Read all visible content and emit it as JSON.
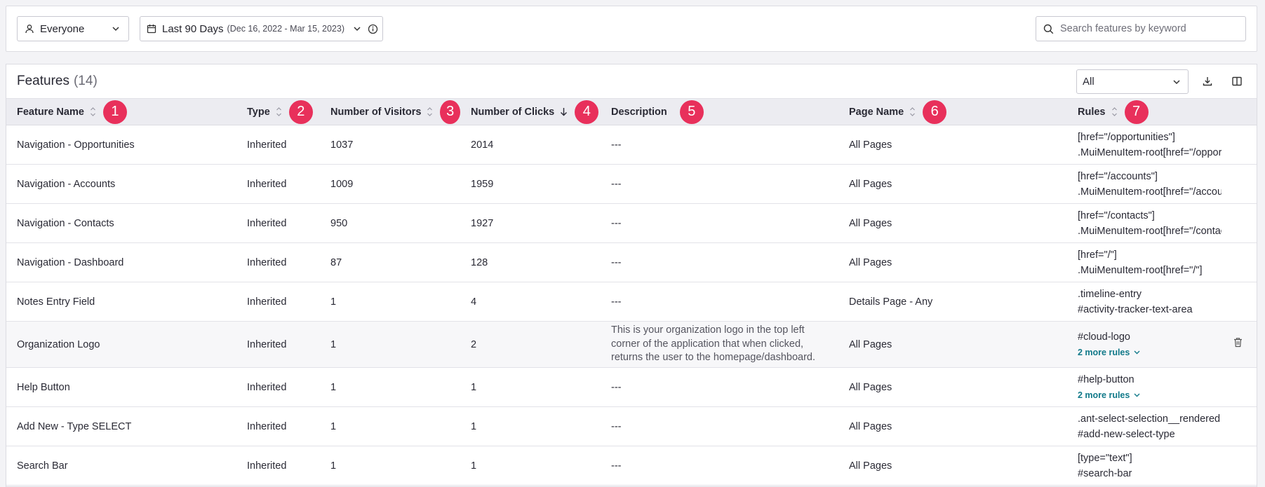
{
  "filters": {
    "segment": "Everyone",
    "date_range": "Last 90 Days",
    "date_detail": "(Dec 16, 2022 - Mar 15, 2023)",
    "search_placeholder": "Search features by keyword"
  },
  "card": {
    "title": "Features",
    "count": "(14)",
    "type_filter": "All"
  },
  "columns": [
    {
      "label": "Feature Name",
      "badge": "1"
    },
    {
      "label": "Type",
      "badge": "2"
    },
    {
      "label": "Number of Visitors",
      "badge": "3"
    },
    {
      "label": "Number of Clicks",
      "badge": "4"
    },
    {
      "label": "Description",
      "badge": "5"
    },
    {
      "label": "Page Name",
      "badge": "6"
    },
    {
      "label": "Rules",
      "badge": "7"
    }
  ],
  "rows": [
    {
      "name": "Navigation - Opportunities",
      "type": "Inherited",
      "visitors": "1037",
      "clicks": "2014",
      "description": "---",
      "page": "All Pages",
      "rule1": "[href=\"/opportunities\"]",
      "rule2": ".MuiMenuItem-root[href=\"/opportunities\"]"
    },
    {
      "name": "Navigation - Accounts",
      "type": "Inherited",
      "visitors": "1009",
      "clicks": "1959",
      "description": "---",
      "page": "All Pages",
      "rule1": "[href=\"/accounts\"]",
      "rule2": ".MuiMenuItem-root[href=\"/accounts\"]"
    },
    {
      "name": "Navigation - Contacts",
      "type": "Inherited",
      "visitors": "950",
      "clicks": "1927",
      "description": "---",
      "page": "All Pages",
      "rule1": "[href=\"/contacts\"]",
      "rule2": ".MuiMenuItem-root[href=\"/contacts\"]"
    },
    {
      "name": "Navigation - Dashboard",
      "type": "Inherited",
      "visitors": "87",
      "clicks": "128",
      "description": "---",
      "page": "All Pages",
      "rule1": "[href=\"/\"]",
      "rule2": ".MuiMenuItem-root[href=\"/\"]"
    },
    {
      "name": "Notes Entry Field",
      "type": "Inherited",
      "visitors": "1",
      "clicks": "4",
      "description": "---",
      "page": "Details Page - Any",
      "rule1": ".timeline-entry",
      "rule2": "#activity-tracker-text-area"
    },
    {
      "name": "Organization Logo",
      "type": "Inherited",
      "visitors": "1",
      "clicks": "2",
      "description": "This is your organization logo in the top left corner of the application that when clicked, returns the user to the homepage/dashboard.",
      "page": "All Pages",
      "rule1": "#cloud-logo",
      "more": "2 more rules"
    },
    {
      "name": "Help Button",
      "type": "Inherited",
      "visitors": "1",
      "clicks": "1",
      "description": "---",
      "page": "All Pages",
      "rule1": "#help-button",
      "more": "2 more rules"
    },
    {
      "name": "Add New - Type SELECT",
      "type": "Inherited",
      "visitors": "1",
      "clicks": "1",
      "description": "---",
      "page": "All Pages",
      "rule1": ".ant-select-selection__rendered",
      "rule2": "#add-new-select-type"
    },
    {
      "name": "Search Bar",
      "type": "Inherited",
      "visitors": "1",
      "clicks": "1",
      "description": "---",
      "page": "All Pages",
      "rule1": "[type=\"text\"]",
      "rule2": "#search-bar"
    }
  ],
  "colors": {
    "badge": "#e8305b",
    "link": "#127a8a",
    "header_bg": "#ececf1"
  }
}
